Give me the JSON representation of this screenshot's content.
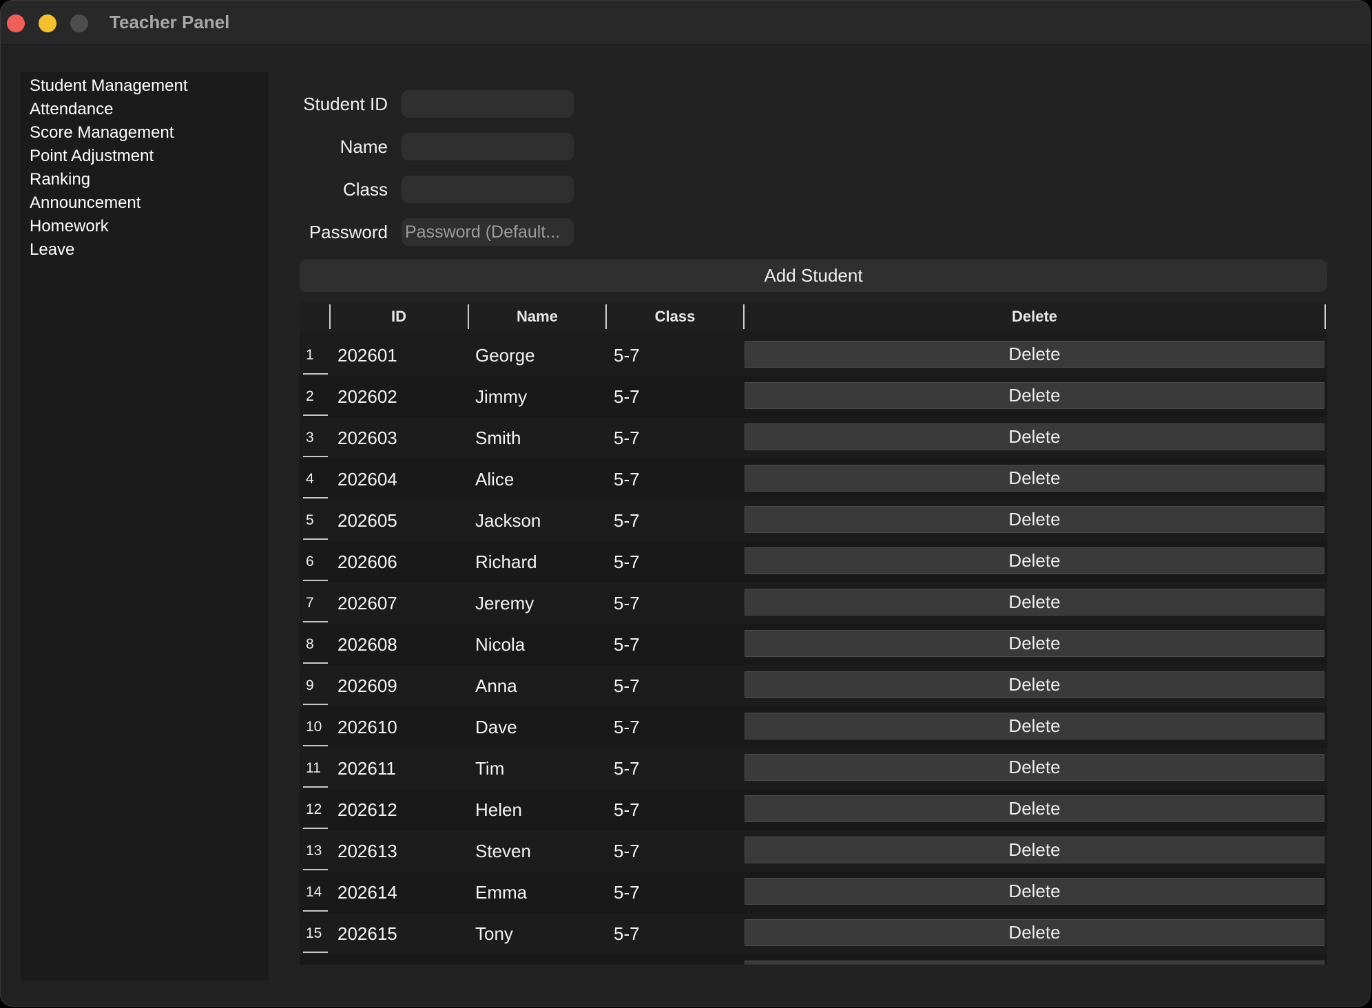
{
  "window": {
    "title": "Teacher Panel"
  },
  "sidebar": {
    "items": [
      {
        "label": "Student Management"
      },
      {
        "label": "Attendance"
      },
      {
        "label": "Score Management"
      },
      {
        "label": "Point Adjustment"
      },
      {
        "label": "Ranking"
      },
      {
        "label": "Announcement"
      },
      {
        "label": "Homework"
      },
      {
        "label": "Leave"
      }
    ]
  },
  "form": {
    "student_id_label": "Student ID",
    "student_id_value": "",
    "name_label": "Name",
    "name_value": "",
    "class_label": "Class",
    "class_value": "",
    "password_label": "Password",
    "password_placeholder": "Password (Default...",
    "add_button_label": "Add Student"
  },
  "table": {
    "headers": {
      "id": "ID",
      "name": "Name",
      "class": "Class",
      "delete": "Delete"
    },
    "delete_label": "Delete",
    "rows": [
      {
        "num": "1",
        "id": "202601",
        "name": "George",
        "class": "5-7"
      },
      {
        "num": "2",
        "id": "202602",
        "name": "Jimmy",
        "class": "5-7"
      },
      {
        "num": "3",
        "id": "202603",
        "name": "Smith",
        "class": "5-7"
      },
      {
        "num": "4",
        "id": "202604",
        "name": "Alice",
        "class": "5-7"
      },
      {
        "num": "5",
        "id": "202605",
        "name": "Jackson",
        "class": "5-7"
      },
      {
        "num": "6",
        "id": "202606",
        "name": "Richard",
        "class": "5-7"
      },
      {
        "num": "7",
        "id": "202607",
        "name": "Jeremy",
        "class": "5-7"
      },
      {
        "num": "8",
        "id": "202608",
        "name": "Nicola",
        "class": "5-7"
      },
      {
        "num": "9",
        "id": "202609",
        "name": "Anna",
        "class": "5-7"
      },
      {
        "num": "10",
        "id": "202610",
        "name": "Dave",
        "class": "5-7"
      },
      {
        "num": "11",
        "id": "202611",
        "name": "Tim",
        "class": "5-7"
      },
      {
        "num": "12",
        "id": "202612",
        "name": "Helen",
        "class": "5-7"
      },
      {
        "num": "13",
        "id": "202613",
        "name": "Steven",
        "class": "5-7"
      },
      {
        "num": "14",
        "id": "202614",
        "name": "Emma",
        "class": "5-7"
      },
      {
        "num": "15",
        "id": "202615",
        "name": "Tony",
        "class": "5-7"
      }
    ]
  },
  "colors": {
    "background": "#222222",
    "sidebar": "#1b1b1b",
    "button": "#3a3a3a",
    "close": "#ee5f57",
    "minimize": "#f5c02e"
  }
}
